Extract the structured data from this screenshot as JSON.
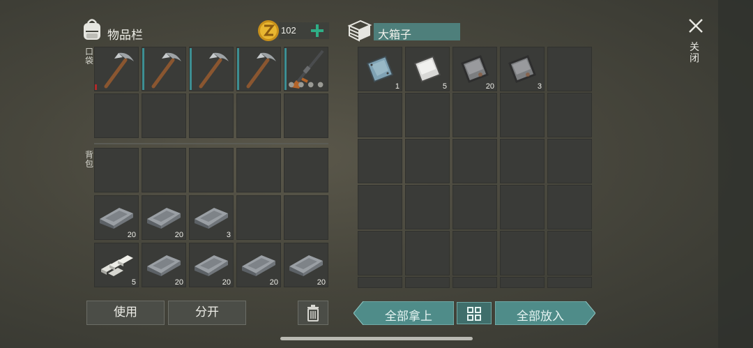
{
  "inventory": {
    "title": "物品栏",
    "coins": "102",
    "pocket_label": "口袋",
    "backpack_label": "背包",
    "pocket_row1": [
      {
        "item": "pickaxe",
        "qty": ""
      },
      {
        "item": "pickaxe",
        "qty": ""
      },
      {
        "item": "pickaxe",
        "qty": ""
      },
      {
        "item": "pickaxe",
        "qty": ""
      },
      {
        "item": "rifle",
        "qty": ""
      }
    ],
    "backpack_row2": [
      {
        "item": "iron-ingot",
        "qty": "20"
      },
      {
        "item": "iron-ingot",
        "qty": "20"
      },
      {
        "item": "iron-ingot",
        "qty": "3"
      }
    ],
    "backpack_row3": [
      {
        "item": "aluminum-bars",
        "qty": "5"
      },
      {
        "item": "iron-ingot",
        "qty": "20"
      },
      {
        "item": "iron-ingot",
        "qty": "20"
      },
      {
        "item": "iron-ingot",
        "qty": "20"
      },
      {
        "item": "iron-ingot",
        "qty": "20"
      }
    ],
    "use_button": "使用",
    "split_button": "分开"
  },
  "box": {
    "title": "大箱子",
    "row1": [
      {
        "item": "steel-plate",
        "qty": "1"
      },
      {
        "item": "aluminum-plate",
        "qty": "5"
      },
      {
        "item": "iron-plate",
        "qty": "20"
      },
      {
        "item": "iron-plate",
        "qty": "3"
      }
    ],
    "take_all_button": "全部拿上",
    "put_all_button": "全部放入"
  },
  "close_label": "关闭",
  "colors": {
    "teal": "#4f8c89",
    "accent": "#2fae86",
    "coin": "#d8a318"
  }
}
